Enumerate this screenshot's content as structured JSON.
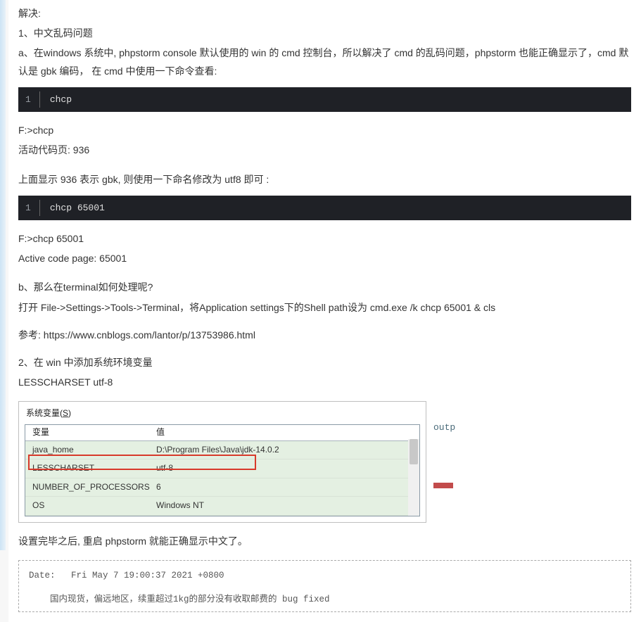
{
  "intro": {
    "line0": "解决:",
    "line1": "1、中文乱码问题",
    "line2": "a、在windows 系统中, phpstorm console 默认使用的 win 的 cmd 控制台，所以解决了 cmd 的乱码问题，phpstorm 也能正确显示了，cmd 默认是 gbk 编码，  在 cmd 中使用一下命令查看:"
  },
  "code1": {
    "ln": "1",
    "cmd": "chcp"
  },
  "after1": {
    "l1": "F:>chcp",
    "l2": "活动代码页: 936",
    "l3": "上面显示 936 表示 gbk, 则使用一下命名修改为 utf8 即可 :"
  },
  "code2": {
    "ln": "1",
    "cmd": "chcp 65001"
  },
  "after2": {
    "l1": "F:>chcp 65001",
    "l2": "Active code page: 65001",
    "l3": "b、那么在terminal如何处理呢?",
    "l4": "打开 File->Settings->Tools->Terminal，将Application settings下的Shell path设为 cmd.exe /k chcp 65001 & cls",
    "l5": "参考: https://www.cnblogs.com/lantor/p/13753986.html",
    "l6": "2、在 win 中添加系统环境变量",
    "l7": "LESSCHARSET utf-8"
  },
  "env": {
    "title_a": "系统变量(",
    "title_u": "S",
    "title_b": ")",
    "head": {
      "c1": "变量",
      "c2": "值"
    },
    "rows": [
      {
        "c1": "java_home",
        "c2": "D:\\Program Files\\Java\\jdk-14.0.2"
      },
      {
        "c1": "LESSCHARSET",
        "c2": "utf-8"
      },
      {
        "c1": "NUMBER_OF_PROCESSORS",
        "c2": "6"
      },
      {
        "c1": "OS",
        "c2": "Windows NT"
      }
    ],
    "side_text": "outp"
  },
  "after_env": "设置完毕之后, 重启 phpstorm 就能正确显示中文了。",
  "gitlog": {
    "l1": "Date:   Fri May 7 19:00:37 2021 +0800",
    "l2": "    国内现货，偏远地区，续重超过1kg的部分没有收取邮费的 bug fixed"
  }
}
